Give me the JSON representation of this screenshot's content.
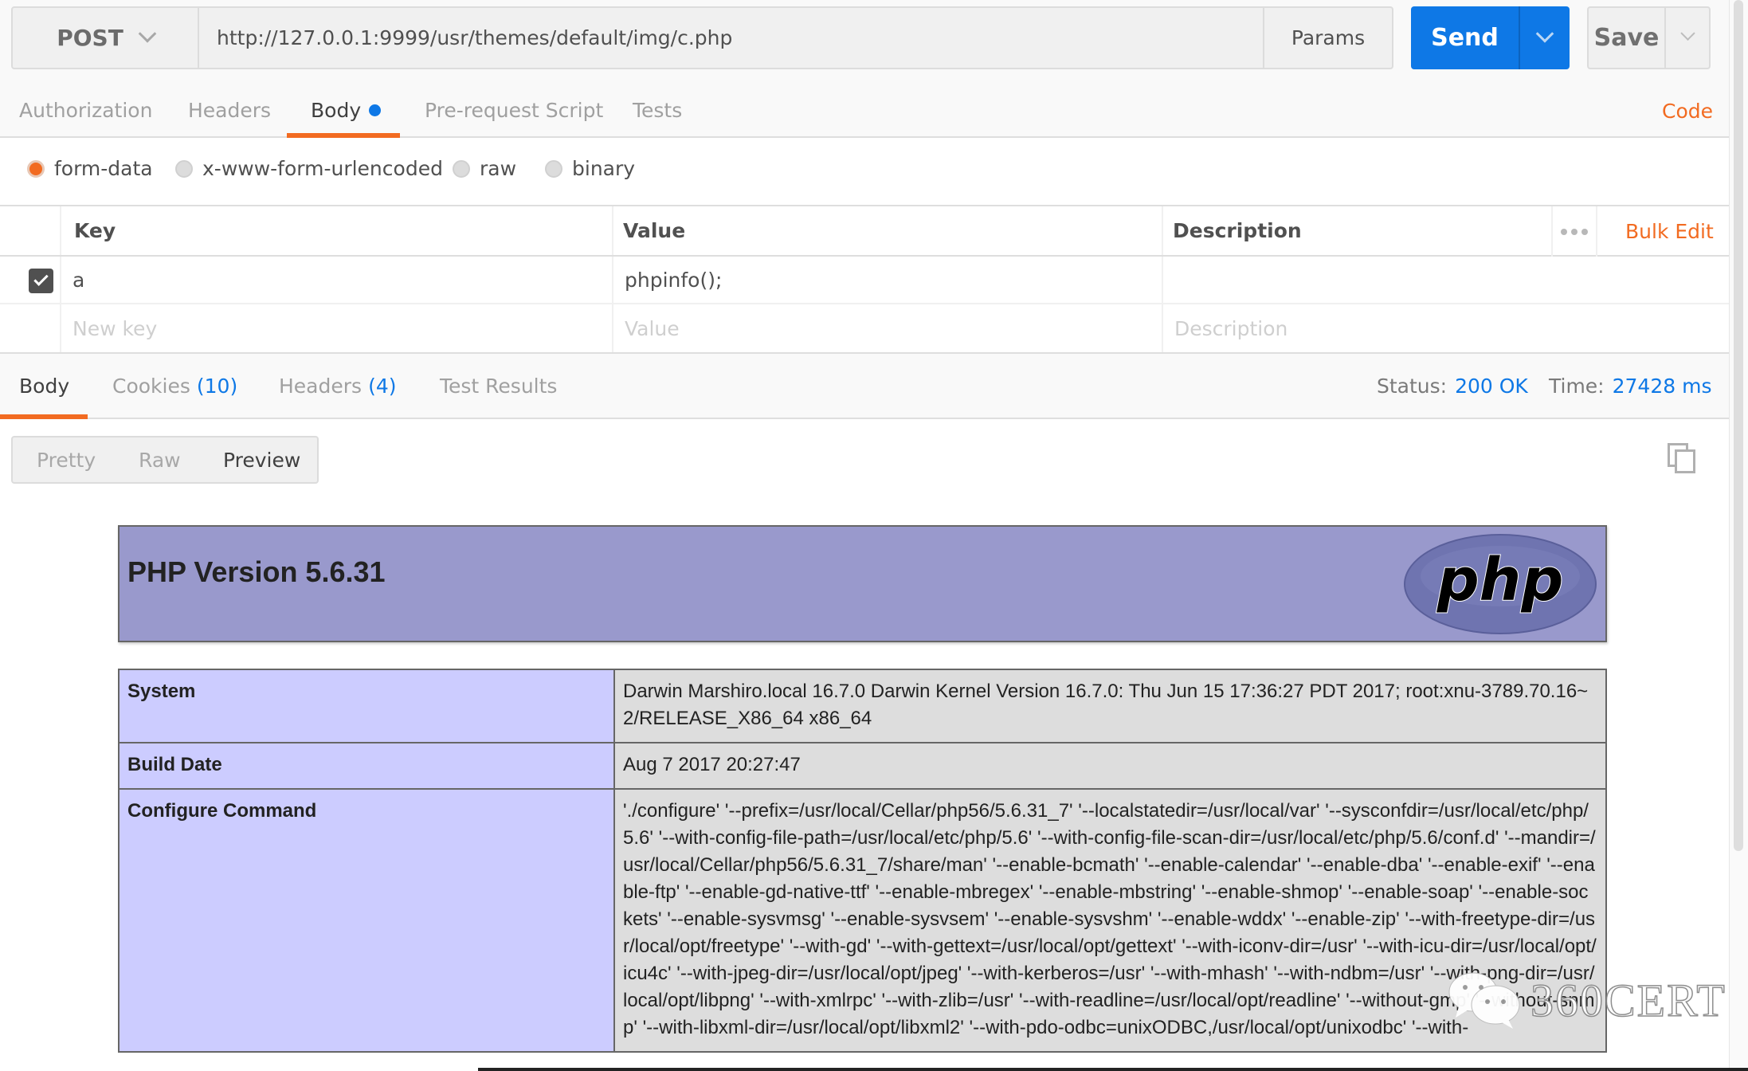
{
  "request": {
    "method": "POST",
    "url": "http://127.0.0.1:9999/usr/themes/default/img/c.php",
    "params_label": "Params",
    "send_label": "Send",
    "save_label": "Save"
  },
  "request_tabs": {
    "items": [
      {
        "label": "Authorization",
        "active": false
      },
      {
        "label": "Headers",
        "active": false
      },
      {
        "label": "Body",
        "active": true,
        "modified_dot": true
      },
      {
        "label": "Pre-request Script",
        "active": false
      },
      {
        "label": "Tests",
        "active": false
      }
    ],
    "code_link": "Code"
  },
  "body_modes": {
    "selected": "form-data",
    "options": [
      "form-data",
      "x-www-form-urlencoded",
      "raw",
      "binary"
    ]
  },
  "form_table": {
    "headers": {
      "key": "Key",
      "value": "Value",
      "description": "Description"
    },
    "bulk_edit": "Bulk Edit",
    "rows": [
      {
        "checked": true,
        "key": "a",
        "value": "phpinfo();",
        "description": ""
      }
    ],
    "new_row": {
      "key_placeholder": "New key",
      "value_placeholder": "Value",
      "description_placeholder": "Description"
    }
  },
  "response": {
    "tabs": [
      {
        "label": "Body",
        "count": "",
        "active": true
      },
      {
        "label": "Cookies",
        "count": "(10)",
        "active": false
      },
      {
        "label": "Headers",
        "count": "(4)",
        "active": false
      },
      {
        "label": "Test Results",
        "count": "",
        "active": false
      }
    ],
    "status_label": "Status:",
    "status_value": "200 OK",
    "time_label": "Time:",
    "time_value": "27428 ms",
    "view_modes": [
      "Pretty",
      "Raw",
      "Preview"
    ],
    "view_selected": "Preview"
  },
  "preview": {
    "title": "PHP Version 5.6.31",
    "logo_text": "php",
    "rows": [
      {
        "label": "System",
        "value": "Darwin Marshiro.local 16.7.0 Darwin Kernel Version 16.7.0: Thu Jun 15 17:36:27 PDT 2017; root:xnu-3789.70.16~2/RELEASE_X86_64 x86_64"
      },
      {
        "label": "Build Date",
        "value": "Aug 7 2017 20:27:47"
      },
      {
        "label": "Configure Command",
        "value": "'./configure' '--prefix=/usr/local/Cellar/php56/5.6.31_7' '--localstatedir=/usr/local/var' '--sysconfdir=/usr/local/etc/php/5.6' '--with-config-file-path=/usr/local/etc/php/5.6' '--with-config-file-scan-dir=/usr/local/etc/php/5.6/conf.d' '--mandir=/usr/local/Cellar/php56/5.6.31_7/share/man' '--enable-bcmath' '--enable-calendar' '--enable-dba' '--enable-exif' '--enable-ftp' '--enable-gd-native-ttf' '--enable-mbregex' '--enable-mbstring' '--enable-shmop' '--enable-soap' '--enable-sockets' '--enable-sysvmsg' '--enable-sysvsem' '--enable-sysvshm' '--enable-wddx' '--enable-zip' '--with-freetype-dir=/usr/local/opt/freetype' '--with-gd' '--with-gettext=/usr/local/opt/gettext' '--with-iconv-dir=/usr' '--with-icu-dir=/usr/local/opt/icu4c' '--with-jpeg-dir=/usr/local/opt/jpeg' '--with-kerberos=/usr' '--with-mhash' '--with-ndbm=/usr' '--with-png-dir=/usr/local/opt/libpng' '--with-xmlrpc' '--with-zlib=/usr' '--with-readline=/usr/local/opt/readline' '--without-gmp' '--without-snmp' '--with-libxml-dir=/usr/local/opt/libxml2' '--with-pdo-odbc=unixODBC,/usr/local/opt/unixodbc' '--with-"
      }
    ]
  },
  "watermark": {
    "text": "360CERT"
  },
  "colors": {
    "accent_orange": "#f26b21",
    "send_blue": "#0e78e6",
    "php_header": "#9999cc",
    "php_label_cell": "#ccccff",
    "php_value_cell": "#dddddd"
  }
}
